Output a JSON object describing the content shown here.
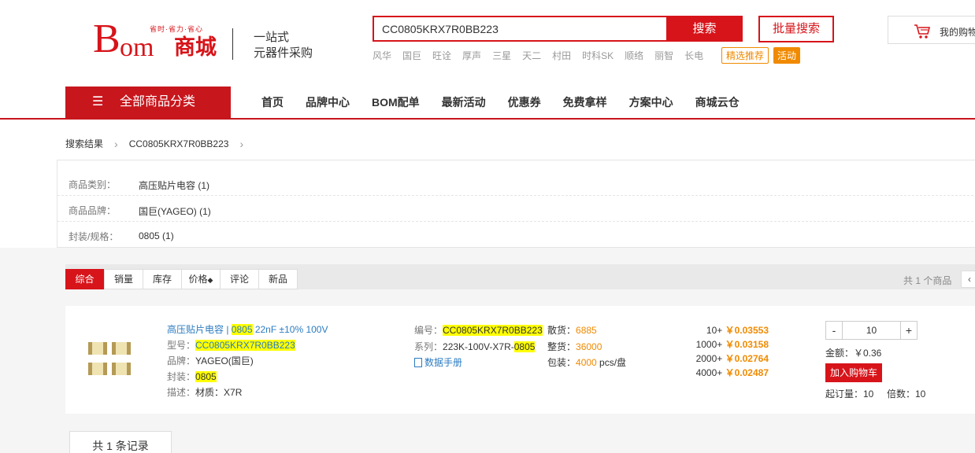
{
  "header": {
    "logo_b": "B",
    "logo_om": "om",
    "logo_shop": "商城",
    "logo_slogan": "省时·省力·省心",
    "tagline_1": "一站式",
    "tagline_2": "元器件采购",
    "search_value": "CC0805KRX7R0BB223",
    "search_button": "搜索",
    "bulk_search_button": "批量搜索",
    "hot_words": [
      "风华",
      "国巨",
      "旺诠",
      "厚声",
      "三星",
      "天二",
      "村田",
      "时科SK",
      "顺络",
      "丽智",
      "长电"
    ],
    "tag_select": "精选推荐",
    "tag_activity": "活动",
    "cart_label": "我的购物车"
  },
  "nav": {
    "category_button": "全部商品分类",
    "items": [
      "首页",
      "品牌中心",
      "BOM配单",
      "最新活动",
      "优惠券",
      "免费拿样",
      "方案中心",
      "商城云仓"
    ]
  },
  "breadcrumb": {
    "root": "搜索结果",
    "current": "CC0805KRX7R0BB223"
  },
  "filters": [
    {
      "key": "商品类别：",
      "value": "高压贴片电容 (1)"
    },
    {
      "key": "商品品牌：",
      "value": "国巨(YAGEO) (1)"
    },
    {
      "key": "封装/规格：",
      "value": "0805 (1)"
    }
  ],
  "sort": {
    "tabs": [
      "综合",
      "销量",
      "库存",
      "价格",
      "评论",
      "新品"
    ],
    "total": "共 1 个商品"
  },
  "product": {
    "title_prefix": "高压贴片电容 | ",
    "title_hl": "0805",
    "title_suffix": " 22nF ±10% 100V",
    "model_label": "型号：",
    "model": "CC0805KRX7R0BB223",
    "brand_label": "品牌：",
    "brand": "YAGEO(国巨)",
    "package_label": "封装：",
    "package": "0805",
    "desc_label": "描述：",
    "desc": "材质：X7R",
    "code_label": "编号：",
    "code": "CC0805KRX7R0BB223",
    "series_label": "系列：",
    "series_prefix": "223K-100V-X7R-",
    "series_hl": "0805",
    "datasheet": "数据手册",
    "loose_label": "散货：",
    "loose": "6885",
    "full_label": "整货：",
    "full": "36000",
    "pack_label": "包装：",
    "pack_value": "4000",
    "pack_unit": " pcs/盘",
    "prices": [
      {
        "qty": "10+",
        "price": "￥0.03553"
      },
      {
        "qty": "1000+",
        "price": "￥0.03158"
      },
      {
        "qty": "2000+",
        "price": "￥0.02764"
      },
      {
        "qty": "4000+",
        "price": "￥0.02487"
      }
    ],
    "qty_value": "10",
    "qty_minus": "-",
    "qty_plus": "+",
    "amount": "金额：￥0.36",
    "add_to_cart": "加入购物车",
    "min_order": "起订量：10",
    "multiple": "倍数：10"
  },
  "records": "共 1 条记录",
  "colors": {
    "brand_red": "#d7141a",
    "accent_orange": "#f08a00",
    "link_blue": "#2b7bc0"
  }
}
